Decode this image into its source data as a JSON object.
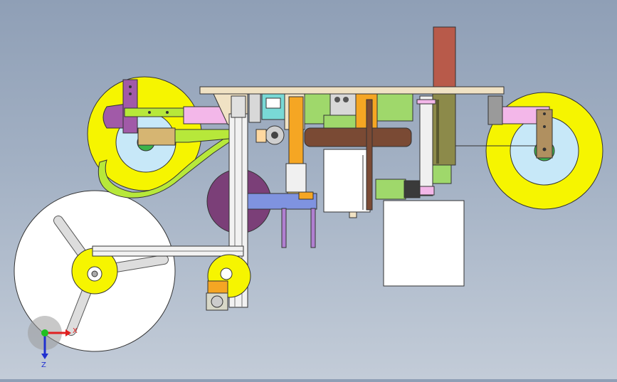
{
  "view": {
    "background_top": "#8f9fb6",
    "background_bottom": "#c3ccd8"
  },
  "triad": {
    "x_label": "X",
    "z_label": "Z",
    "x_color": "#e02020",
    "z_color": "#2030d0",
    "y_color": "#20c020"
  },
  "colors": {
    "reel_yellow": "#f6f500",
    "hub_lightblue": "#c7e8f8",
    "hub_green": "#3bb34b",
    "purple_bracket": "#a15aa8",
    "pink_arm": "#f3b7e9",
    "lime_guide": "#b7e83a",
    "frame_beige": "#f0e2c4",
    "orange_column": "#f5a623",
    "brown_roller": "#7a4a34",
    "dark_purple_disc": "#7b3f78",
    "periwinkle_plate": "#7f93e0",
    "sienna_motor": "#b85a4a",
    "olive_panel": "#8c8a4a",
    "teal_box": "#79d9d6",
    "green_block": "#9fd86b",
    "white_box": "#ffffff"
  }
}
